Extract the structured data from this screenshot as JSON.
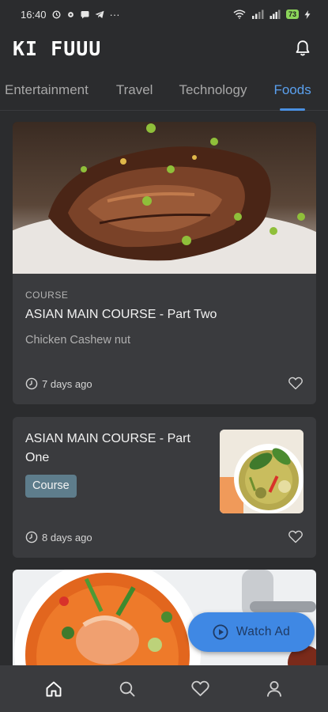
{
  "status_bar": {
    "time": "16:40",
    "more": "···",
    "battery": "73"
  },
  "app": {
    "logo": "KI FUUU"
  },
  "tabs": [
    {
      "label": "Entertainment",
      "active": false
    },
    {
      "label": "Travel",
      "active": false
    },
    {
      "label": "Technology",
      "active": false
    },
    {
      "label": "Foods",
      "active": true
    }
  ],
  "posts": [
    {
      "kicker": "COURSE",
      "title": "ASIAN MAIN COURSE - Part Two",
      "subtitle": "Chicken Cashew nut",
      "time": "7 days ago"
    },
    {
      "title": "ASIAN MAIN COURSE - Part One",
      "tag": "Course",
      "time": "8 days ago"
    }
  ],
  "watch_ad": {
    "label": "Watch Ad"
  },
  "colors": {
    "background": "#2b2c2e",
    "card": "#3a3b3e",
    "accent": "#4a90e2",
    "chip": "#5e7d8c"
  },
  "icons": [
    "bell-icon",
    "clock-icon",
    "heart-icon",
    "play-icon",
    "home-icon",
    "search-icon",
    "heart-icon",
    "profile-icon"
  ]
}
